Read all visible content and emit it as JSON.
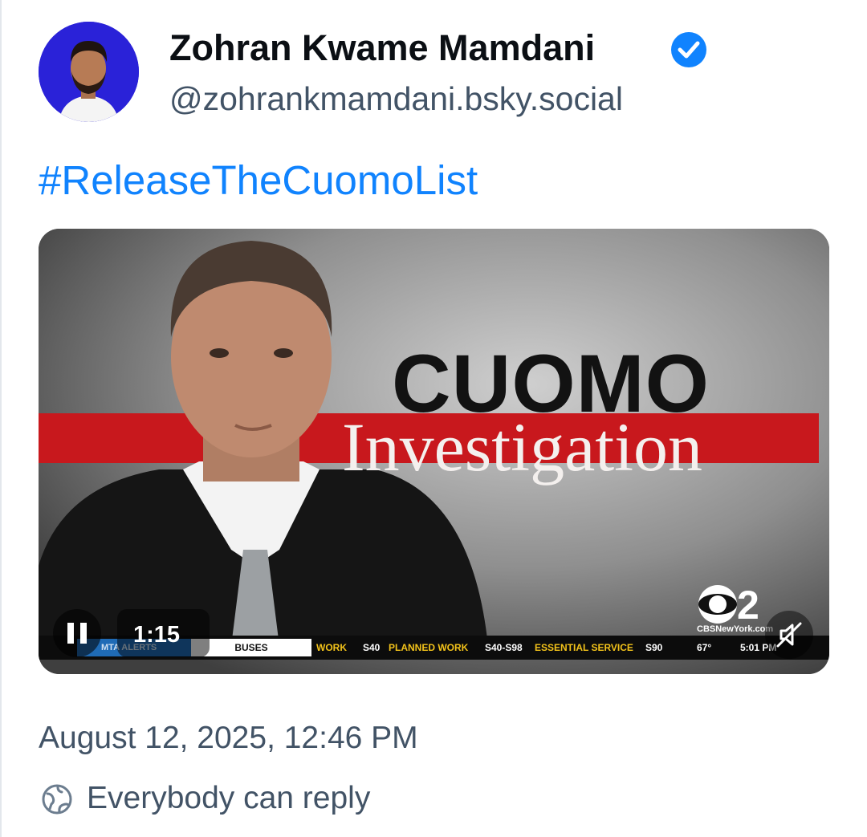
{
  "post": {
    "author": {
      "display_name": "Zohran Kwame Mamdani",
      "handle": "@zohrankmamdani.bsky.social",
      "verified": true,
      "avatar_bg": "#2a22d8"
    },
    "text": "#ReleaseTheCuomoList",
    "video": {
      "headline": "CUOMO",
      "subhead": "Investigation",
      "network_logo": "CBS 2",
      "network_site": "CBSNewYork.com",
      "ticker": {
        "alerts": "MTA ALERTS",
        "buses": "BUSES",
        "work": "WORK",
        "s40": "S40",
        "planned_work": "PLANNED WORK",
        "s40_s98": "S40-S98",
        "essential_service": "ESSENTIAL SERVICE",
        "s90": "S90",
        "temperature": "67°",
        "clock": "5:01 PM"
      },
      "timestamp": "1:15",
      "playing": true,
      "muted": true
    },
    "date": "August 12, 2025, 12:46 PM",
    "reply_setting": "Everybody can reply"
  },
  "colors": {
    "link": "#1083fe",
    "muted_text": "#425366",
    "verified_badge": "#1083fe",
    "banner_red": "#c8181d"
  },
  "icons": {
    "verified": "verified-check-icon",
    "pause": "pause-icon",
    "mute": "volume-muted-icon",
    "reply": "globe-icon"
  }
}
